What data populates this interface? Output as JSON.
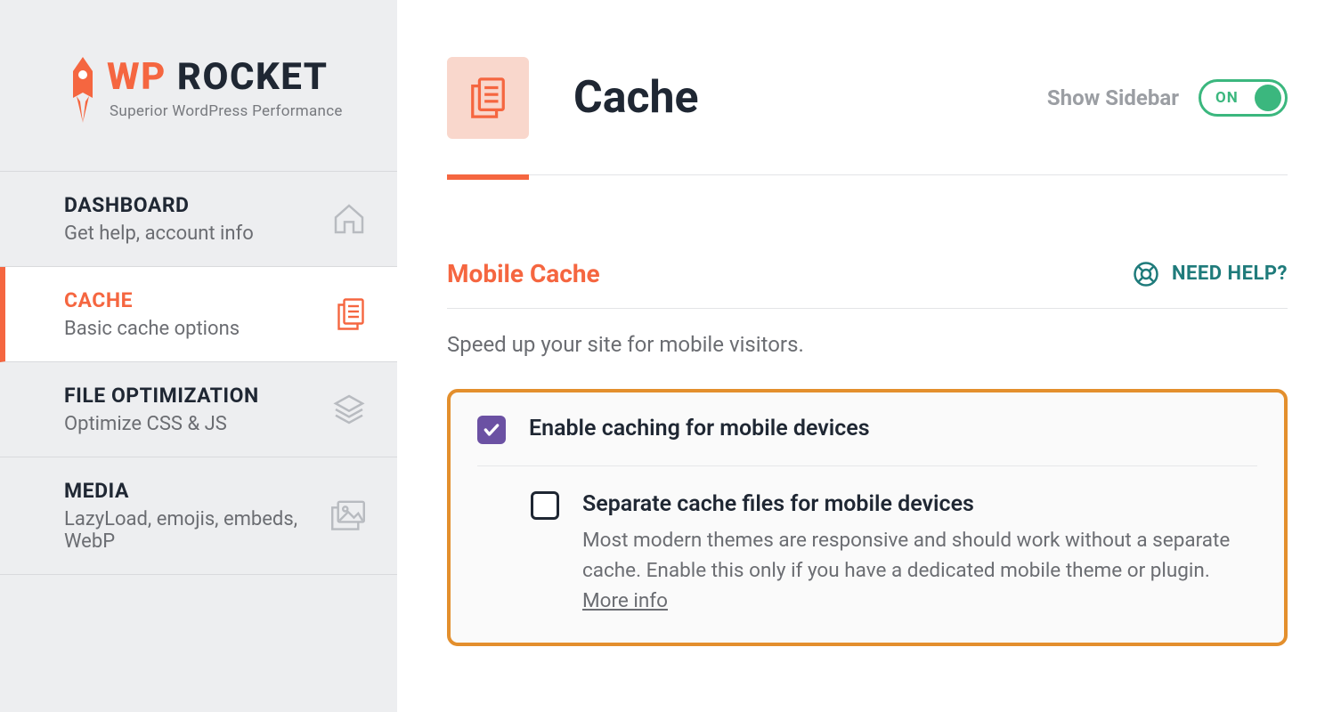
{
  "logo": {
    "wp": "WP",
    "rocket": "ROCKET",
    "tagline": "Superior WordPress Performance"
  },
  "nav": {
    "dashboard": {
      "title": "DASHBOARD",
      "sub": "Get help, account info"
    },
    "cache": {
      "title": "CACHE",
      "sub": "Basic cache options"
    },
    "file_opt": {
      "title": "FILE OPTIMIZATION",
      "sub": "Optimize CSS & JS"
    },
    "media": {
      "title": "MEDIA",
      "sub": "LazyLoad, emojis, embeds, WebP"
    }
  },
  "header": {
    "title": "Cache",
    "show_sidebar": "Show Sidebar",
    "toggle_on": "ON"
  },
  "section": {
    "title": "Mobile Cache",
    "help": "NEED HELP?",
    "desc": "Speed up your site for mobile visitors.",
    "opt1_label": "Enable caching for mobile devices",
    "opt2_label": "Separate cache files for mobile devices",
    "opt2_desc": "Most modern themes are responsive and should work without a separate cache. Enable this only if you have a dedicated mobile theme or plugin. ",
    "more_info": "More info"
  }
}
